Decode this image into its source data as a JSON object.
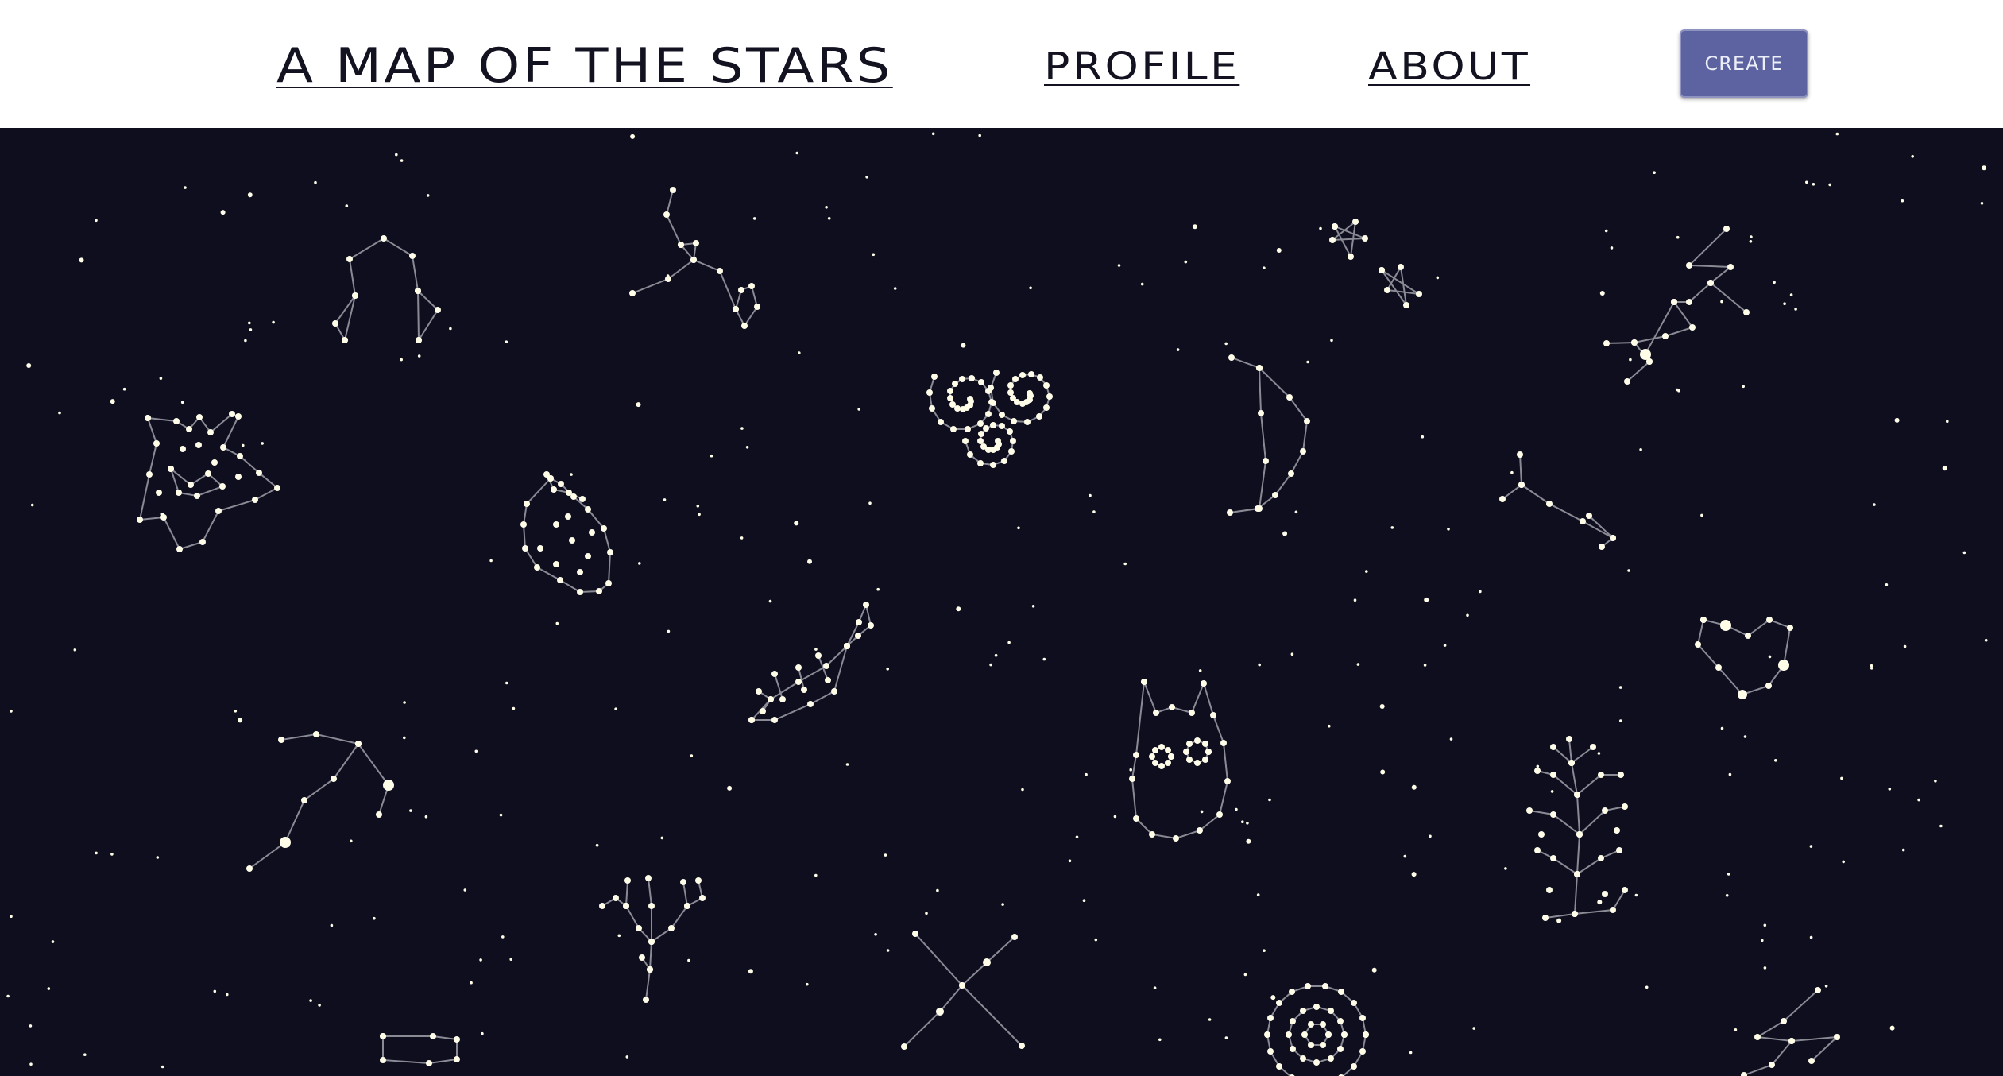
{
  "header": {
    "brand": "A MAP OF THE STARS",
    "nav": {
      "profile": "PROFILE",
      "about": "ABOUT"
    },
    "create_label": "CREATE"
  },
  "colors": {
    "header_bg": "#ffffff",
    "sky_bg": "#0e0e1f",
    "star": "#fffde8",
    "constellation_line": "#8a8a95",
    "button_bg": "#5d63a0",
    "text": "#121220"
  },
  "constellations": [
    "arches",
    "dragon",
    "star-pair",
    "ladder-cluster",
    "flower",
    "strawberry",
    "swirls",
    "crescent-moon",
    "arrow",
    "fish-bone",
    "owl",
    "heart",
    "archer",
    "tree",
    "cross",
    "donut",
    "leafy-branch",
    "lightning"
  ]
}
